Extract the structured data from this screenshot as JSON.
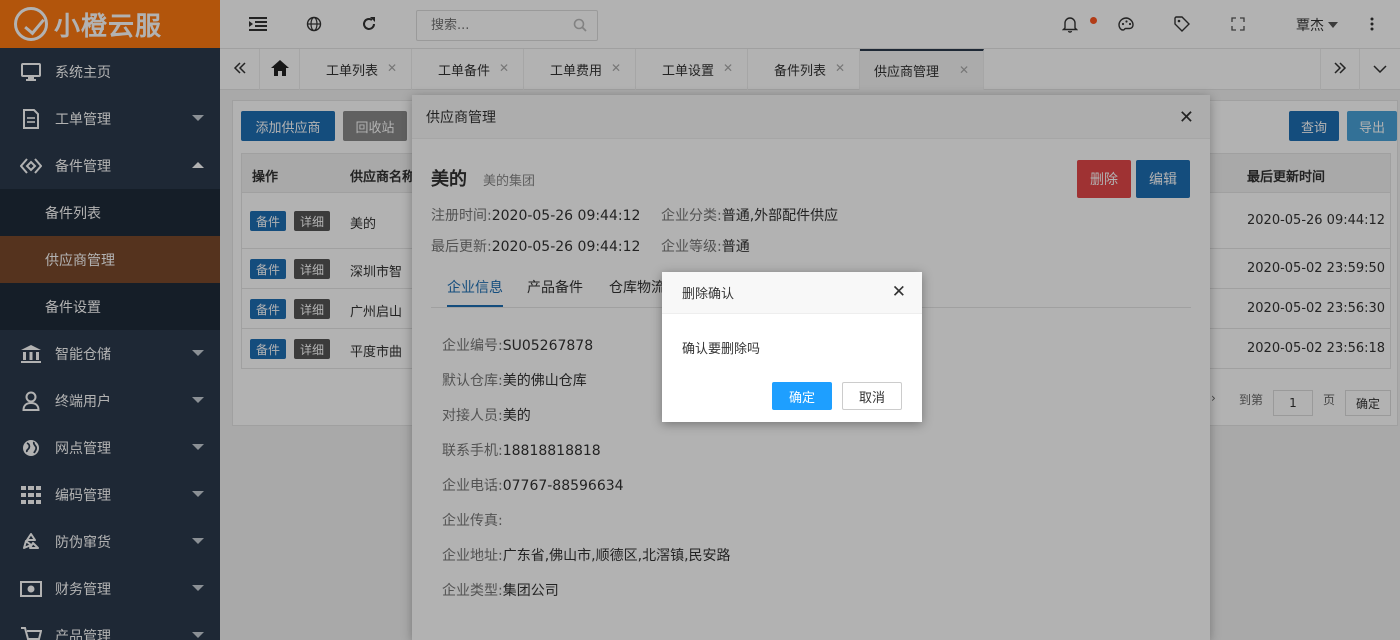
{
  "app": {
    "logo_text": "小橙云服"
  },
  "sidebar": {
    "items": [
      {
        "label": "系统主页",
        "icon": "monitor-icon"
      },
      {
        "label": "工单管理",
        "icon": "document-icon"
      },
      {
        "label": "备件管理",
        "icon": "diamond-icon"
      },
      {
        "label": "智能仓储",
        "icon": "bank-icon"
      },
      {
        "label": "终端用户",
        "icon": "user-icon"
      },
      {
        "label": "网点管理",
        "icon": "globe-icon"
      },
      {
        "label": "编码管理",
        "icon": "grid-icon"
      },
      {
        "label": "防伪窜货",
        "icon": "recycle-icon"
      },
      {
        "label": "财务管理",
        "icon": "money-icon"
      },
      {
        "label": "产品管理",
        "icon": "cart-icon"
      }
    ],
    "submenu": [
      "备件列表",
      "供应商管理",
      "备件设置"
    ]
  },
  "topbar": {
    "search_placeholder": "搜索...",
    "user_name": "覃杰"
  },
  "tabs": [
    "工单列表",
    "工单备件",
    "工单费用",
    "工单设置",
    "备件列表",
    "供应商管理"
  ],
  "page": {
    "add_button": "添加供应商",
    "recycle_button": "回收站",
    "query_button": "查询",
    "export_button": "导出",
    "table": {
      "headers": {
        "ops": "操作",
        "name": "供应商名称",
        "updated": "最后更新时间"
      },
      "btn_parts": "备件",
      "btn_detail": "详细",
      "rows": [
        {
          "name": "美的",
          "updated": "2020-05-26 09:44:12"
        },
        {
          "name": "深圳市智",
          "updated": "2020-05-02 23:59:50"
        },
        {
          "name": "广州启山",
          "updated": "2020-05-02 23:56:30"
        },
        {
          "name": "平度市曲",
          "updated": "2020-05-02 23:56:18"
        }
      ]
    },
    "pager": {
      "goto": "到第",
      "page_input": "1",
      "page_unit": "页",
      "confirm": "确定"
    }
  },
  "supplier_modal": {
    "title": "供应商管理",
    "name": "美的",
    "group": "美的集团",
    "delete_button": "删除",
    "edit_button": "编辑",
    "meta": {
      "reg_label": "注册时间:",
      "reg_value": "2020-05-26 09:44:12",
      "category_label": "企业分类:",
      "category_value": "普通,外部配件供应",
      "updated_label": "最后更新:",
      "updated_value": "2020-05-26 09:44:12",
      "level_label": "企业等级:",
      "level_value": "普通"
    },
    "tabs": [
      "企业信息",
      "产品备件",
      "仓库物流"
    ],
    "info": [
      {
        "label": "企业编号:",
        "value": "SU05267878"
      },
      {
        "label": "默认仓库:",
        "value": "美的佛山仓库"
      },
      {
        "label": "对接人员:",
        "value": "美的"
      },
      {
        "label": "联系手机:",
        "value": "18818818818"
      },
      {
        "label": "企业电话:",
        "value": "07767-88596634"
      },
      {
        "label": "企业传真:",
        "value": ""
      },
      {
        "label": "企业地址:",
        "value": "广东省,佛山市,顺德区,北滘镇,民安路"
      },
      {
        "label": "企业类型:",
        "value": "集团公司"
      }
    ]
  },
  "confirm_dialog": {
    "title": "删除确认",
    "message": "确认要删除吗",
    "ok": "确定",
    "cancel": "取消"
  },
  "colors": {
    "brand": "#ff7a12",
    "sidebar": "#2b3a4d",
    "primary": "#1e9fff",
    "danger": "#e4484a",
    "edit": "#1e6fb4"
  }
}
